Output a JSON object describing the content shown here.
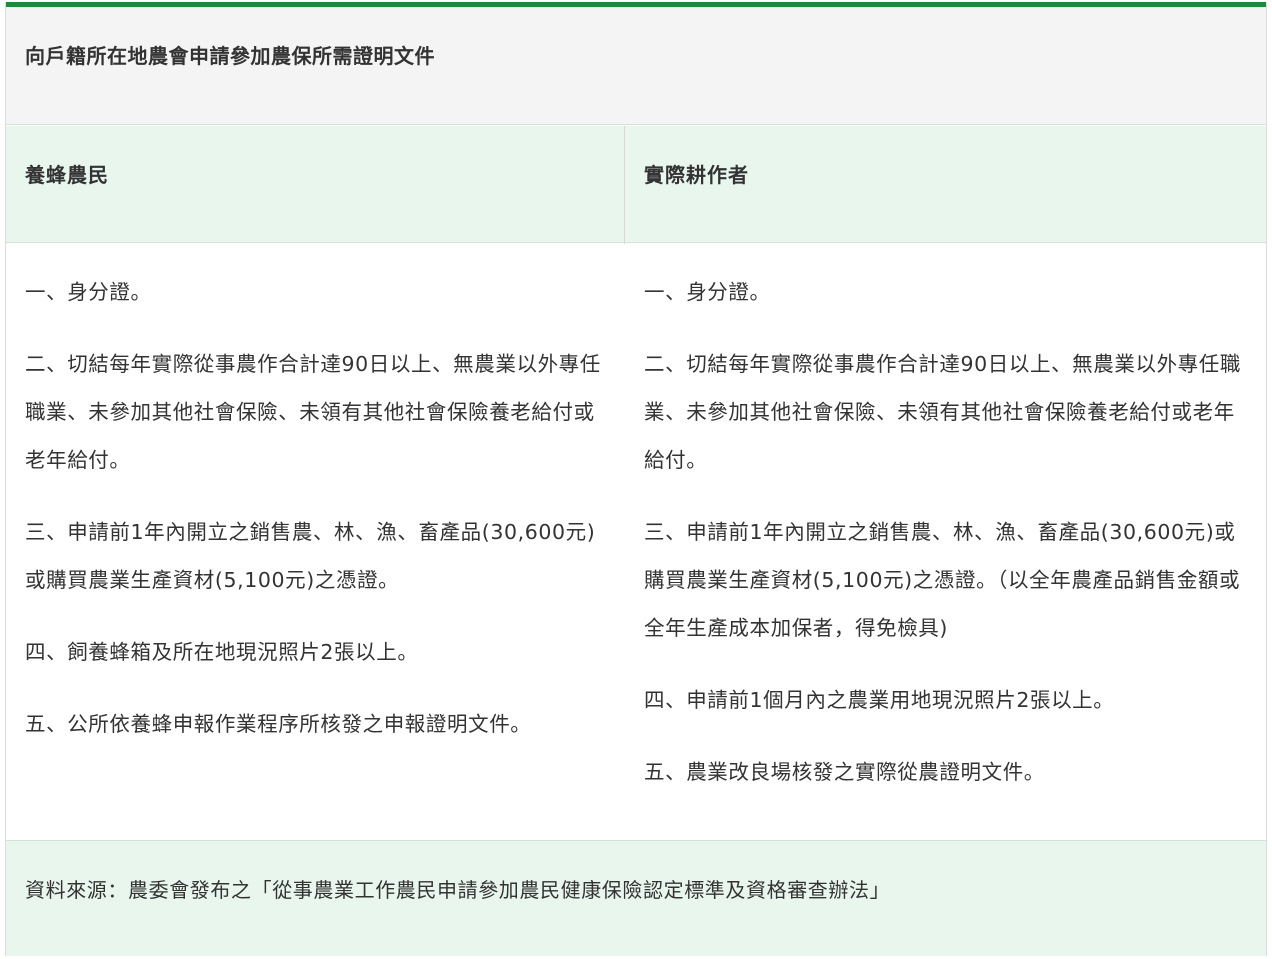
{
  "table": {
    "title": "向戶籍所在地農會申請參加農保所需證明文件",
    "columns": [
      "養蜂農民",
      "實際耕作者"
    ],
    "rows": {
      "beekeeper": [
        "一、身分證。",
        "二、切結每年實際從事農作合計達90日以上、無農業以外專任職業、未參加其他社會保險、未領有其他社會保險養老給付或老年給付。",
        "三、申請前1年內開立之銷售農、林、漁、畜產品(30,600元)或購買農業生產資材(5,100元)之憑證。",
        "四、飼養蜂箱及所在地現況照片2張以上。",
        "五、公所依養蜂申報作業程序所核發之申報證明文件。"
      ],
      "cultivator": [
        "一、身分證。",
        "二、切結每年實際從事農作合計達90日以上、無農業以外專任職業、未參加其他社會保險、未領有其他社會保險養老給付或老年給付。",
        "三、申請前1年內開立之銷售農、林、漁、畜產品(30,600元)或購買農業生產資材(5,100元)之憑證。（以全年農產品銷售金額或全年生產成本加保者，得免檢具)",
        "四、申請前1個月內之農業用地現況照片2張以上。",
        "五、農業改良場核發之實際從農證明文件。"
      ]
    },
    "source": "資料來源：農委會發布之「從事農業工作農民申請參加農民健康保險認定標準及資格審查辦法」"
  },
  "colors": {
    "accent_bar": "#1e8a3a",
    "header_bg": "#e8f6ee",
    "title_bg": "#f4f4f4"
  }
}
